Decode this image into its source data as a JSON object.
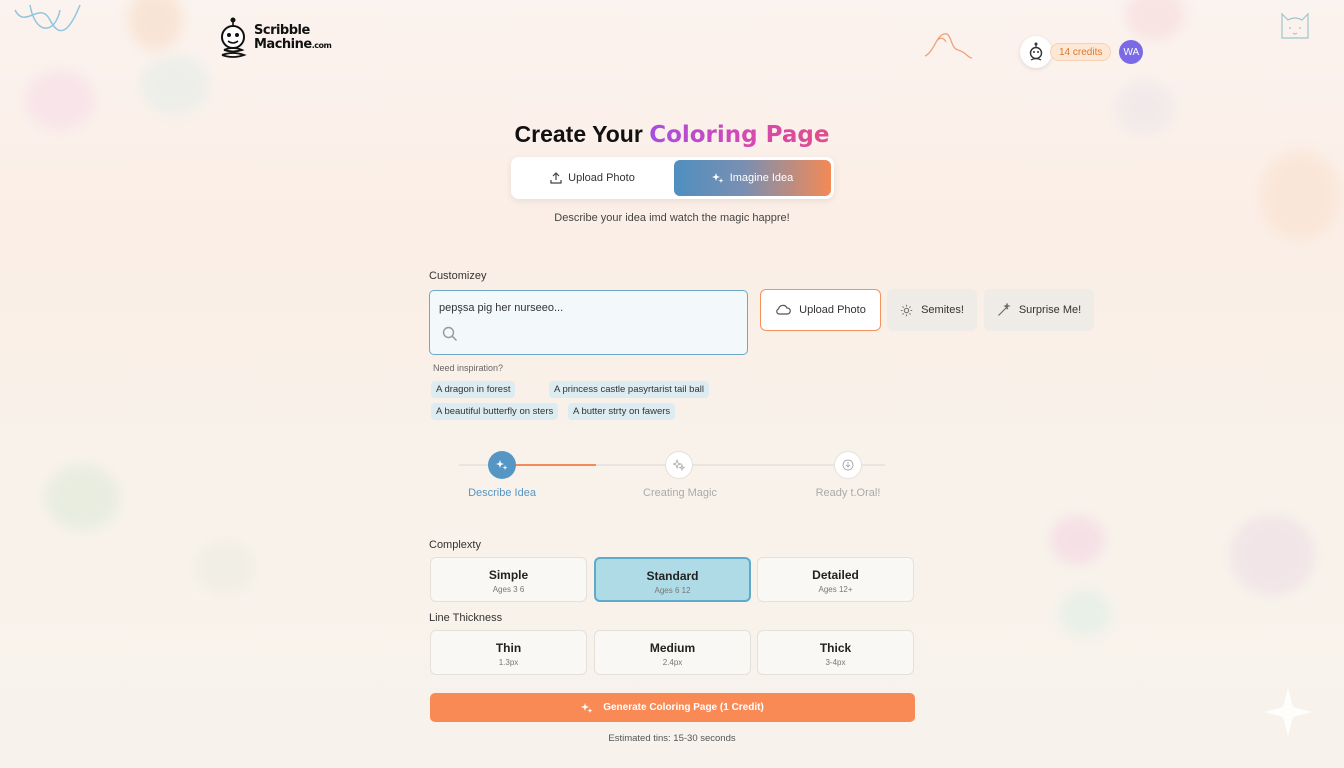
{
  "brand": {
    "name_line1": "Scribble",
    "name_line2": "Machine",
    "name_suffix": ".com"
  },
  "user": {
    "credits": "14 credits",
    "avatar_initials": "WA"
  },
  "page": {
    "title_plain": "Create Your",
    "title_highlight": "Coloring Page",
    "subtitle": "Describe your idea imd watch the magic happre!"
  },
  "mode_tabs": [
    {
      "label": "Upload Photo",
      "icon": "upload-icon",
      "active": false
    },
    {
      "label": "Imagine Idea",
      "icon": "sparkle-icon",
      "active": true
    }
  ],
  "customize": {
    "label": "Customizey",
    "prompt_value": "pepşsa pig her nurseeo...",
    "actions": [
      {
        "label": "Upload Photo",
        "icon": "cloud-icon"
      },
      {
        "label": "Semites!",
        "icon": "settings-icon"
      },
      {
        "label": "Surprise Me!",
        "icon": "magic-wand-icon"
      }
    ],
    "inspiration_label": "Need inspiration?",
    "suggestions": [
      "A dragon in forest",
      "A princess castle pasyrtarist tail ball",
      "A beautiful butterfly on sters",
      "A butter strty on fawers"
    ]
  },
  "steps": [
    {
      "label": "Describe Idea",
      "icon": "sparkle-icon",
      "state": "active"
    },
    {
      "label": "Creating Magic",
      "icon": "sparkle-icon",
      "state": "pending"
    },
    {
      "label": "Ready t.Oral!",
      "icon": "download-icon",
      "state": "pending"
    }
  ],
  "complexity": {
    "label": "Complexty",
    "options": [
      {
        "title": "Simple",
        "sub": "Ages 3 6",
        "selected": false
      },
      {
        "title": "Standard",
        "sub": "Ages 6 12",
        "selected": true
      },
      {
        "title": "Detailed",
        "sub": "Ages 12+",
        "selected": false
      }
    ]
  },
  "line_thickness": {
    "label": "Line Thickness",
    "options": [
      {
        "title": "Thin",
        "sub": "1.3px",
        "selected": false
      },
      {
        "title": "Medium",
        "sub": "2.4px",
        "selected": false
      },
      {
        "title": "Thick",
        "sub": "3-4px",
        "selected": false
      }
    ]
  },
  "generate": {
    "label": "Generate Coloring Page (1 Credit)",
    "estimate": "Estimated tins: 15-30 seconds"
  },
  "colors": {
    "accent_orange": "#f98a56",
    "accent_blue": "#5596c4",
    "title_gradient_start": "#a54fe0",
    "title_gradient_end": "#e14d8a"
  }
}
